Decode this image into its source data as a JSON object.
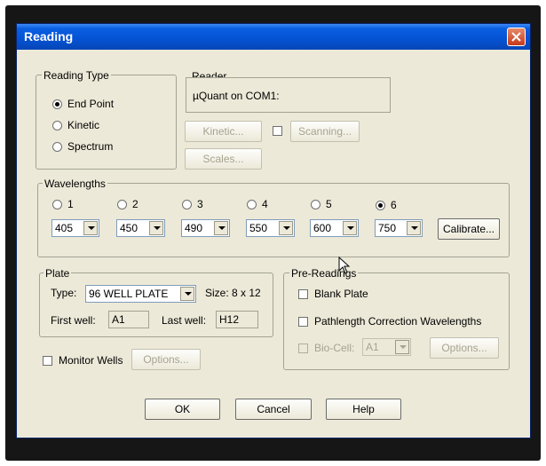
{
  "window": {
    "title": "Reading"
  },
  "reading_type": {
    "legend": "Reading Type",
    "options": [
      {
        "label": "End Point",
        "checked": true
      },
      {
        "label": "Kinetic",
        "checked": false
      },
      {
        "label": "Spectrum",
        "checked": false
      }
    ]
  },
  "reader": {
    "legend": "Reader",
    "value": "µQuant on COM1:",
    "kinetic_button": "Kinetic...",
    "scanning_button": "Scanning...",
    "scales_button": "Scales..."
  },
  "wavelengths": {
    "legend": "Wavelengths",
    "items": [
      {
        "label": "1",
        "value": "405",
        "checked": false
      },
      {
        "label": "2",
        "value": "450",
        "checked": false
      },
      {
        "label": "3",
        "value": "490",
        "checked": false
      },
      {
        "label": "4",
        "value": "550",
        "checked": false
      },
      {
        "label": "5",
        "value": "600",
        "checked": false
      },
      {
        "label": "6",
        "value": "750",
        "checked": true
      }
    ],
    "calibrate_button": "Calibrate..."
  },
  "plate": {
    "legend": "Plate",
    "type_label": "Type:",
    "type_value": "96 WELL PLATE",
    "size_text": "Size: 8 x 12",
    "first_well_label": "First well:",
    "first_well_value": "A1",
    "last_well_label": "Last well:",
    "last_well_value": "H12"
  },
  "pre_readings": {
    "legend": "Pre-Readings",
    "blank_plate": "Blank Plate",
    "pathlength": "Pathlength Correction Wavelengths",
    "bio_cell": "Bio-Cell:",
    "bio_cell_value": "A1",
    "options_button": "Options..."
  },
  "monitor_wells": {
    "label": "Monitor Wells",
    "options_button": "Options..."
  },
  "footer": {
    "ok": "OK",
    "cancel": "Cancel",
    "help": "Help"
  },
  "colors": {
    "titlebar": "#0552d4",
    "dialog_face": "#ece9d8",
    "disabled_text": "#a6a38f"
  }
}
